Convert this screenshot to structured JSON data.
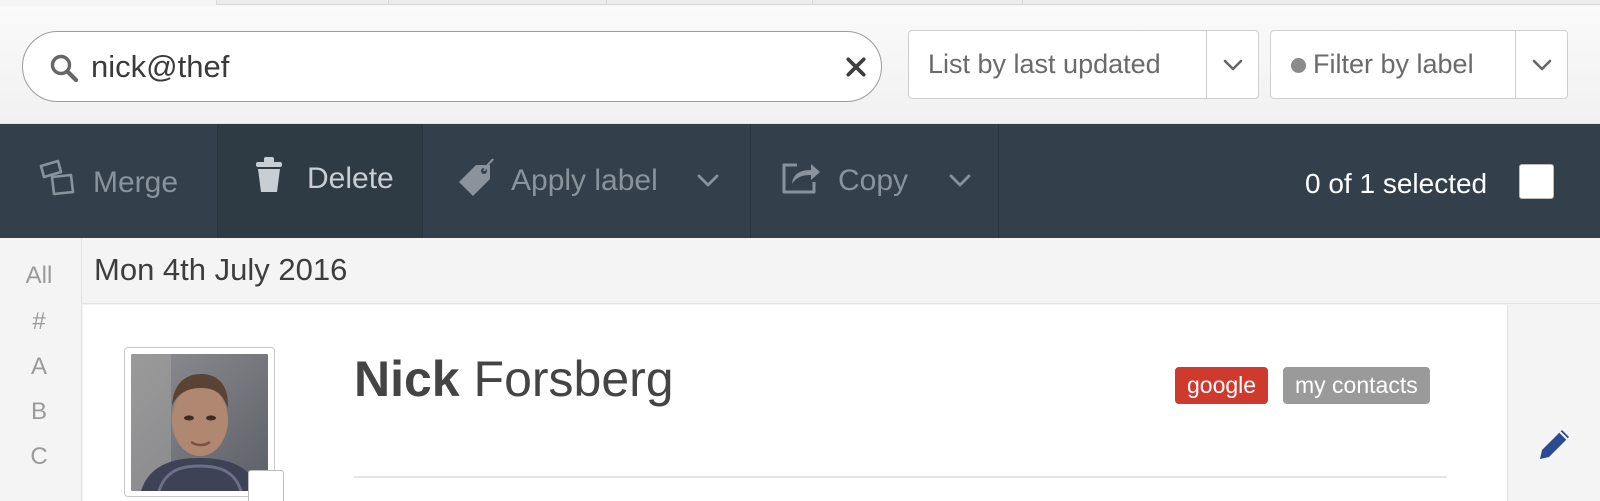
{
  "search": {
    "value": "nick@thef",
    "placeholder": ""
  },
  "sort_dropdown": {
    "label": "List by last updated"
  },
  "label_filter": {
    "label": "Filter by label"
  },
  "toolbar": {
    "merge": "Merge",
    "delete": "Delete",
    "apply_label": "Apply label",
    "copy": "Copy",
    "selection": "0 of 1 selected"
  },
  "index": [
    "All",
    "#",
    "A",
    "B",
    "C"
  ],
  "date_header": "Mon 4th July 2016",
  "contact": {
    "first_name": "Nick",
    "last_name": "Forsberg",
    "tags": [
      "google",
      "my contacts"
    ]
  },
  "colors": {
    "toolbar_bg": "#33404b",
    "tag_google": "#cf3a2f",
    "tag_mine": "#9a9a9a",
    "edit_icon": "#2c4a8f"
  }
}
